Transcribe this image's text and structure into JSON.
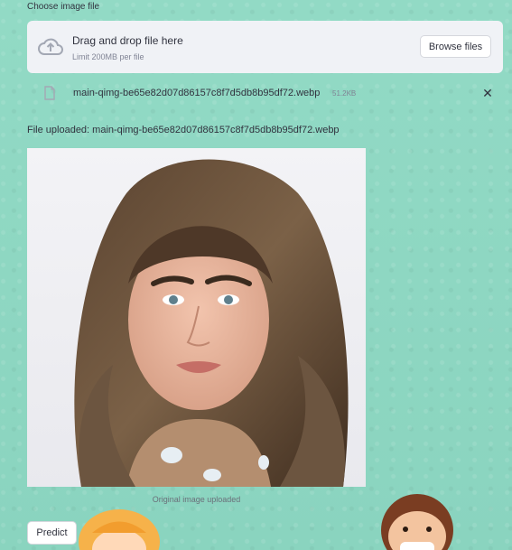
{
  "uploader": {
    "label": "Choose image file",
    "drop_title": "Drag and drop file here",
    "limit_text": "Limit 200MB per file",
    "browse_label": "Browse files"
  },
  "file": {
    "name": "main-qimg-be65e82d07d86157c8f7d5db8b95df72.webp",
    "size": "51.2KB",
    "remove_symbol": "✕"
  },
  "status": {
    "uploaded_text": "File uploaded: main-qimg-be65e82d07d86157c8f7d5db8b95df72.webp"
  },
  "image": {
    "caption": "Original image uploaded"
  },
  "actions": {
    "predict_label": "Predict"
  },
  "colors": {
    "background": "#8fd8c2",
    "dropzone": "#f0f2f6",
    "text": "#31333f",
    "muted": "#808495"
  }
}
